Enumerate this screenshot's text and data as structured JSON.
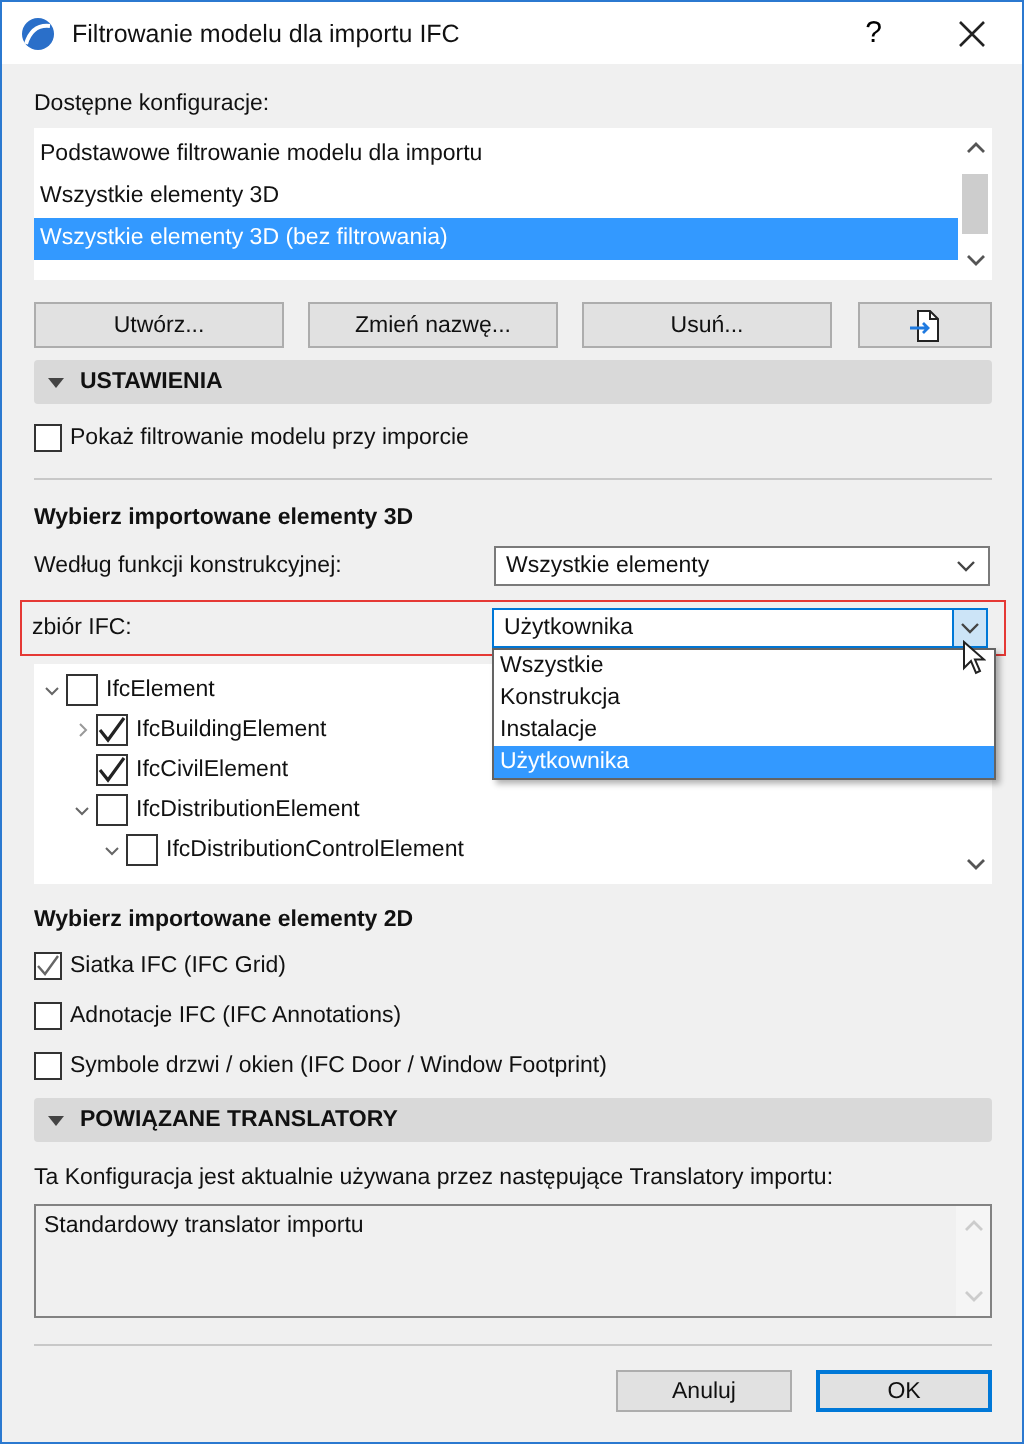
{
  "window": {
    "title": "Filtrowanie modelu dla importu IFC",
    "help": "?"
  },
  "configurations": {
    "label": "Dostępne konfiguracje:",
    "items": [
      {
        "label": "Podstawowe filtrowanie modelu dla importu",
        "selected": false
      },
      {
        "label": "Wszystkie elementy 3D",
        "selected": false
      },
      {
        "label": "Wszystkie elementy 3D (bez filtrowania)",
        "selected": true
      }
    ]
  },
  "config_buttons": [
    "Utwórz...",
    "Zmień nazwę...",
    "Usuń..."
  ],
  "settings": {
    "title": "USTAWIENIA",
    "expanded": true,
    "show_filtering": {
      "label": "Pokaż filtrowanie modelu przy imporcie",
      "checked": false
    }
  },
  "elements_3d": {
    "title": "Wybierz importowane elementy 3D",
    "by_function": {
      "label": "Według funkcji konstrukcyjnej:",
      "value": "Wszystkie elementy"
    },
    "ifc_set": {
      "label": "zbiór IFC:",
      "value": "Użytkownika",
      "open": true,
      "options": [
        {
          "label": "Wszystkie",
          "selected": false
        },
        {
          "label": "Konstrukcja",
          "selected": false
        },
        {
          "label": "Instalacje",
          "selected": false
        },
        {
          "label": "Użytkownika",
          "selected": true
        }
      ]
    },
    "tree": [
      {
        "label": "IfcElement",
        "checked": false,
        "expanded": true,
        "children": [
          {
            "label": "IfcBuildingElement",
            "checked": true,
            "expanded": false
          },
          {
            "label": "IfcCivilElement",
            "checked": true
          },
          {
            "label": "IfcDistributionElement",
            "checked": false,
            "expanded": true,
            "children": [
              {
                "label": "IfcDistributionControlElement",
                "checked": false,
                "expanded": true
              }
            ]
          }
        ]
      }
    ]
  },
  "elements_2d": {
    "title": "Wybierz importowane elementy 2D",
    "items": [
      {
        "label": "Siatka IFC (IFC Grid)",
        "checked": true
      },
      {
        "label": "Adnotacje IFC (IFC Annotations)",
        "checked": false
      },
      {
        "label": "Symbole drzwi / okien (IFC Door / Window Footprint)",
        "checked": false
      }
    ]
  },
  "translators": {
    "title": "POWIĄZANE TRANSLATORY",
    "expanded": true,
    "description": "Ta Konfiguracja jest aktualnie używana przez następujące Translatory importu:",
    "items": [
      "Standardowy translator importu"
    ]
  },
  "buttons": [
    {
      "label": "Anuluj",
      "default": false
    },
    {
      "label": "OK",
      "default": true
    }
  ]
}
